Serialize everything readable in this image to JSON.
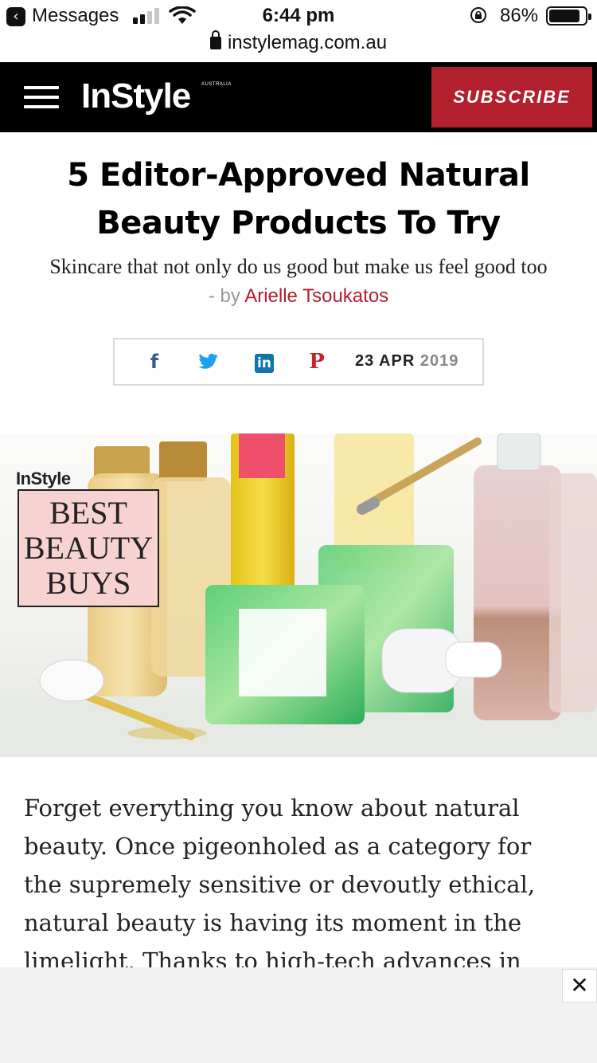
{
  "status_bar": {
    "back_app": "Messages",
    "time": "6:44 pm",
    "battery_percent": "86%",
    "battery_level": 0.86,
    "url": "instylemag.com.au",
    "back_glyph": "‹"
  },
  "header": {
    "logo": "InStyle",
    "logo_sub": "AUSTRALIA",
    "subscribe_label": "SUBSCRIBE",
    "menu_icon": "hamburger-menu-icon"
  },
  "article": {
    "title": "5 Editor-Approved Natural Beauty Products To Try",
    "subtitle": "Skincare that not only do us good but make us feel good too",
    "byline_prefix": "- by",
    "author": "Arielle Tsoukatos",
    "date_day_month": "23 APR",
    "date_year": "2019",
    "share": {
      "facebook": "f",
      "linkedin": "in",
      "pinterest": "P"
    }
  },
  "hero": {
    "badge_brand": "InStyle",
    "badge_line1": "BEST",
    "badge_line2": "BEAUTY",
    "badge_line3": "BUYS"
  },
  "body": {
    "paragraph": "Forget everything you know about natural beauty. Once pigeonholed as a category for the supremely sensitive or devoutly ethical, natural beauty is having its moment in the limelight. Thanks to high-tech advances in formulating"
  },
  "ad": {
    "close_glyph": "✕"
  },
  "colors": {
    "brand_red": "#b21f2d",
    "header_bg": "#000000",
    "badge_pink": "#f6d3d1"
  }
}
